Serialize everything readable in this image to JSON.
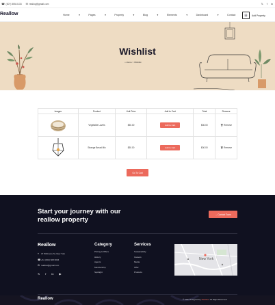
{
  "topbar": {
    "phone": "(307) 555-0133",
    "email": "realloy@gmail.com",
    "social_icons": [
      "twitter-icon",
      "facebook-icon",
      "linkedin-icon"
    ]
  },
  "nav": {
    "logo": "Reallow",
    "menu": [
      "Home",
      "Pages",
      "Property",
      "Blog",
      "Elements",
      "Dashboard",
      "Contact"
    ],
    "add_property": "Add Property"
  },
  "hero": {
    "title": "Wishlist",
    "crumb_home": "Home",
    "crumb_sep": ">",
    "crumb_current": "Wishlist"
  },
  "table": {
    "headers": [
      "Images",
      "Product",
      "Unit Price",
      "Add to Cart",
      "Total",
      "Remove"
    ],
    "rows": [
      {
        "product": "Vegetable Lavels",
        "unit_price": "$30.00",
        "add_label": "Add to Cart",
        "total": "$30.00",
        "remove": "Remove"
      },
      {
        "product": "Strange Bread Mix",
        "unit_price": "$30.00",
        "add_label": "Add to Cart",
        "total": "$30.00",
        "remove": "Remove"
      }
    ]
  },
  "back_button": "Go To Cart",
  "footer": {
    "cta_line1": "Start your journey with our",
    "cta_line2": "reallow property",
    "contact_button": "→ Contact Tours",
    "logo": "Reallow",
    "address": "37 Whitmore St, New York",
    "phone": "+61 (302) 608 6094",
    "email": "reallow@gmail.com",
    "category_title": "Category",
    "category_items": [
      "Pricing & Offers",
      "History",
      "Agents",
      "Membership",
      "Spotlight"
    ],
    "services_title": "Services",
    "services_items": [
      "Sustainability",
      "Careers",
      "Media",
      "Offer",
      "Products"
    ],
    "map_label": "New York",
    "bottom_logo": "Reallow",
    "copyright_pre": "© 2024 designed by",
    "copyright_brand": "Reallow",
    "copyright_post": ". All Right Reserved."
  }
}
